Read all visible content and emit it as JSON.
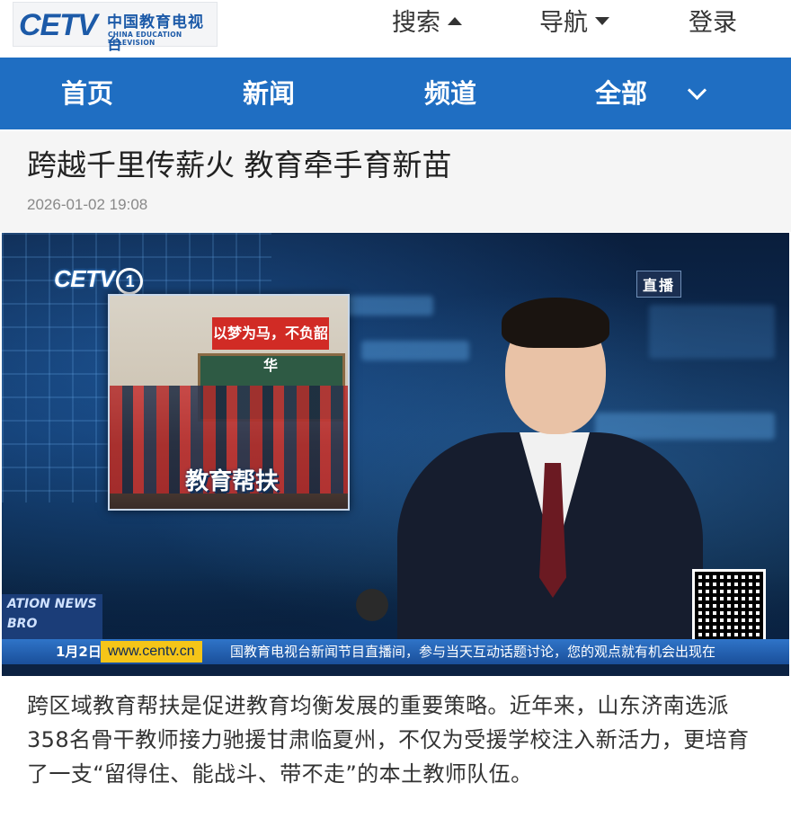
{
  "header": {
    "logo_text": "CETV",
    "logo_cn": "中国教育电视台",
    "logo_en": "CHINA EDUCATION TELEVISION",
    "search_label": "搜索",
    "nav_label": "导航",
    "login_label": "登录"
  },
  "navbar": {
    "items": [
      {
        "label": "首页"
      },
      {
        "label": "新闻"
      },
      {
        "label": "频道"
      },
      {
        "label": "全部"
      }
    ],
    "expand_icon": "chevron-down-icon",
    "background": "#1f6ec2"
  },
  "article": {
    "title": "跨越千里传薪火 教育牵手育新苗",
    "timestamp": "2026-01-02 19:08",
    "body": "跨区域教育帮扶是促进教育均衡发展的重要策略。近年来，山东济南选派358名骨干教师接力驰援甘肃临夏州，不仅为受援学校注入新活力，更培育了一支“留得住、能战斗、带不走”的本土教师队伍。"
  },
  "video": {
    "channel_logo": "CETV",
    "channel_number": "1",
    "live_badge": "直播",
    "inset_banner": "以梦为马，不负韶华",
    "inset_caption": "教育帮扶",
    "news_logo_text": "ATION NEWS BRO",
    "ticker_date": "1月2日",
    "ticker_url": "www.centv.cn",
    "ticker_text": "国教育电视台新闻节目直播间，参与当天互动话题讨论，您的观点就有机会出现在"
  }
}
